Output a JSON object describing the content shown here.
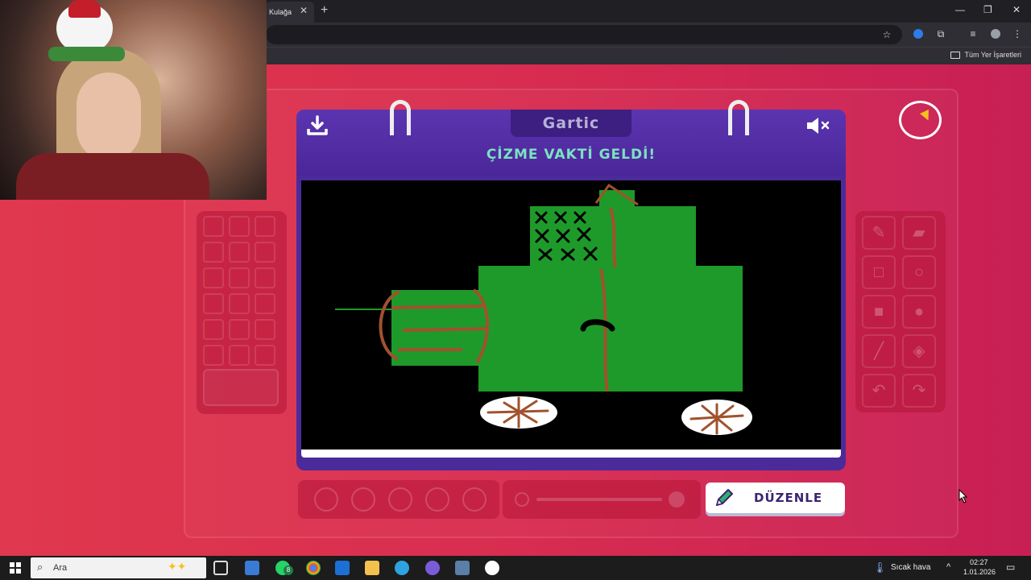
{
  "browser": {
    "tab_title": "Kulağa",
    "tab_close": "✕",
    "new_tab": "+",
    "bookmark_folder": "Tüm Yer İşaretleri",
    "window_controls": [
      "—",
      "❐",
      "✕"
    ]
  },
  "game": {
    "logo": "Gartic",
    "header_title": "ÇİZME VAKTİ GELDİ!",
    "edit_button": "DÜZENLE",
    "timer_fraction": 0.12,
    "accent_color": "#7be2c0",
    "board_color": "#4b2a9a"
  },
  "tools": {
    "items": [
      "pencil-icon",
      "eraser-icon",
      "square-outline-icon",
      "circle-outline-icon",
      "square-fill-icon",
      "circle-fill-icon",
      "line-icon",
      "bucket-icon",
      "undo-icon",
      "redo-icon"
    ]
  },
  "taskbar": {
    "search_placeholder": "Ara",
    "weather": "Sıcak hava",
    "time": "02:27",
    "date": "1.01.2026",
    "whatsapp_badge": "8"
  }
}
